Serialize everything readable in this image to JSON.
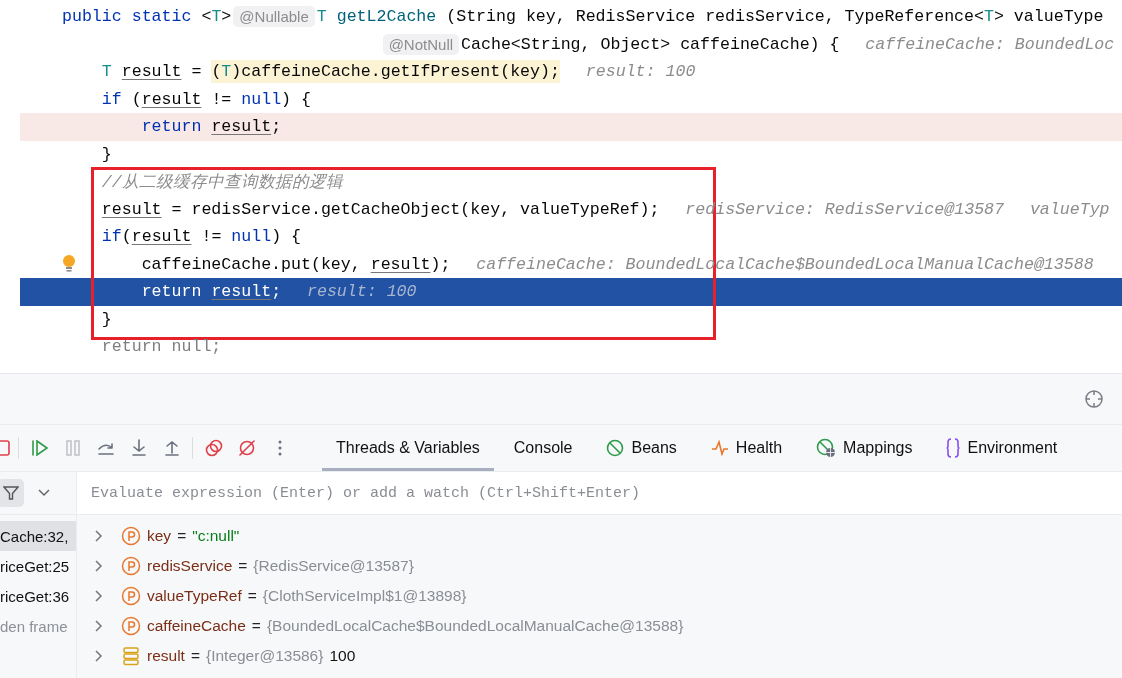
{
  "editor": {
    "lines": [
      {
        "kind": "code",
        "tinted": false,
        "execution_point": false,
        "bulb": false,
        "segments": [
          {
            "kind": "code",
            "tokens": [
              {
                "kind": "keyword",
                "text": "public static "
              },
              {
                "kind": "plain",
                "text": "<"
              },
              {
                "kind": "type",
                "text": "T"
              },
              {
                "kind": "plain",
                "text": ">"
              }
            ]
          },
          {
            "kind": "annotation",
            "text": "@Nullable"
          },
          {
            "kind": "code",
            "tokens": [
              {
                "kind": "type",
                "text": "T"
              },
              {
                "kind": "method",
                "text": " getL2Cache"
              },
              {
                "kind": "plain",
                "text": " (String key, RedisService redisService, TypeReference<"
              },
              {
                "kind": "type",
                "text": "T"
              },
              {
                "kind": "plain",
                "text": "> valueType"
              }
            ]
          }
        ],
        "children": [
          {
            "kind": "continuation",
            "tinted": false,
            "execution_point": false,
            "bulb": false,
            "segments": [
              {
                "kind": "annotation",
                "text": "@NotNull"
              },
              {
                "kind": "code",
                "tokens": [
                  {
                    "kind": "plain",
                    "text": "Cache<String, Object> caffeineCache) {"
                  }
                ]
              },
              {
                "kind": "hint",
                "text": "caffeineCache: BoundedLoc"
              }
            ]
          },
          {
            "kind": "code",
            "tinted": false,
            "execution_point": false,
            "bulb": false,
            "segments": [
              {
                "kind": "code",
                "tokens": [
                  {
                    "kind": "type",
                    "text": "T "
                  },
                  {
                    "kind": "var",
                    "text": "result"
                  },
                  {
                    "kind": "plain",
                    "text": " = "
                  },
                  {
                    "kind": "shade",
                    "tokens": [
                      {
                        "kind": "plain",
                        "text": "("
                      },
                      {
                        "kind": "type",
                        "text": "T"
                      },
                      {
                        "kind": "plain",
                        "text": ")caffeineCache.getIfPresent(key);"
                      }
                    ]
                  }
                ]
              },
              {
                "kind": "hint",
                "text": "result: 100"
              }
            ]
          },
          {
            "kind": "code",
            "tinted": false,
            "execution_point": false,
            "bulb": false,
            "segments": [
              {
                "kind": "code",
                "tokens": [
                  {
                    "kind": "keyword",
                    "text": "if"
                  },
                  {
                    "kind": "plain",
                    "text": " ("
                  },
                  {
                    "kind": "var",
                    "text": "result"
                  },
                  {
                    "kind": "plain",
                    "text": " != "
                  },
                  {
                    "kind": "keyword",
                    "text": "null"
                  },
                  {
                    "kind": "plain",
                    "text": ") {"
                  }
                ]
              }
            ],
            "children": [
              {
                "kind": "code",
                "tinted": true,
                "execution_point": false,
                "bulb": false,
                "segments": [
                  {
                    "kind": "code",
                    "tokens": [
                      {
                        "kind": "keyword",
                        "text": "return "
                      },
                      {
                        "kind": "var",
                        "text": "result"
                      },
                      {
                        "kind": "plain",
                        "text": ";"
                      }
                    ]
                  }
                ]
              }
            ]
          },
          {
            "kind": "code",
            "tinted": false,
            "execution_point": false,
            "bulb": false,
            "segments": [
              {
                "kind": "code",
                "tokens": [
                  {
                    "kind": "plain",
                    "text": "}"
                  }
                ]
              }
            ]
          },
          {
            "kind": "code",
            "tinted": false,
            "execution_point": false,
            "bulb": false,
            "segments": [
              {
                "kind": "code",
                "tokens": [
                  {
                    "kind": "comment",
                    "text": "//从二级缓存中查询数据的逻辑"
                  }
                ]
              }
            ]
          },
          {
            "kind": "code",
            "tinted": false,
            "execution_point": false,
            "bulb": false,
            "segments": [
              {
                "kind": "code",
                "tokens": [
                  {
                    "kind": "var",
                    "text": "result"
                  },
                  {
                    "kind": "plain",
                    "text": " = redisService.getCacheObject(key, valueTypeRef);"
                  }
                ]
              },
              {
                "kind": "hint",
                "text": "redisService: RedisService@13587"
              },
              {
                "kind": "hint",
                "text": "valueTyp"
              }
            ]
          },
          {
            "kind": "code",
            "tinted": false,
            "execution_point": false,
            "bulb": false,
            "segments": [
              {
                "kind": "code",
                "tokens": [
                  {
                    "kind": "keyword",
                    "text": "if"
                  },
                  {
                    "kind": "plain",
                    "text": "("
                  },
                  {
                    "kind": "var",
                    "text": "result"
                  },
                  {
                    "kind": "plain",
                    "text": " != "
                  },
                  {
                    "kind": "keyword",
                    "text": "null"
                  },
                  {
                    "kind": "plain",
                    "text": ") {"
                  }
                ]
              }
            ],
            "children": [
              {
                "kind": "code",
                "tinted": false,
                "execution_point": false,
                "bulb": true,
                "segments": [
                  {
                    "kind": "code",
                    "tokens": [
                      {
                        "kind": "plain",
                        "text": "caffeineCache.put(key, "
                      },
                      {
                        "kind": "var",
                        "text": "result"
                      },
                      {
                        "kind": "plain",
                        "text": ");"
                      }
                    ]
                  },
                  {
                    "kind": "hint",
                    "text": "caffeineCache: BoundedLocalCache$BoundedLocalManualCache@13588"
                  }
                ]
              },
              {
                "kind": "code",
                "tinted": false,
                "execution_point": true,
                "bulb": false,
                "segments": [
                  {
                    "kind": "code",
                    "tokens": [
                      {
                        "kind": "keyword",
                        "text": "return "
                      },
                      {
                        "kind": "var",
                        "text": "result"
                      },
                      {
                        "kind": "plain",
                        "text": ";"
                      }
                    ]
                  },
                  {
                    "kind": "hint",
                    "text": "result: 100"
                  }
                ]
              }
            ]
          },
          {
            "kind": "code",
            "tinted": false,
            "execution_point": false,
            "bulb": false,
            "segments": [
              {
                "kind": "code",
                "tokens": [
                  {
                    "kind": "plain",
                    "text": "}"
                  }
                ]
              }
            ]
          },
          {
            "kind": "code",
            "tinted": false,
            "execution_point": false,
            "bulb": false,
            "segments": [
              {
                "kind": "code",
                "tokens": [
                  {
                    "kind": "dim",
                    "text": "return null;"
                  }
                ]
              }
            ]
          }
        ]
      }
    ]
  },
  "debugger": {
    "toolbar": [
      {
        "disabled": false
      },
      {
        "disabled": false
      },
      {
        "disabled": true
      },
      {
        "disabled": false
      },
      {
        "disabled": false
      },
      {
        "disabled": false
      },
      {
        "disabled": false
      },
      {
        "disabled": false
      },
      {
        "disabled": false
      }
    ],
    "tabs": [
      {
        "label": "Threads & Variables",
        "selected": true
      },
      {
        "label": "Console",
        "selected": false
      },
      {
        "label": "Beans",
        "selected": false
      },
      {
        "label": "Health",
        "selected": false
      },
      {
        "label": "Mappings",
        "selected": false
      },
      {
        "label": "Environment",
        "selected": false
      }
    ],
    "evaluate": {
      "placeholder": "Evaluate expression (Enter) or add a watch (Ctrl+Shift+Enter)"
    },
    "frames": [
      {
        "kind": "frame",
        "text": "Cache:32,",
        "selected": true
      },
      {
        "kind": "frame",
        "text": "riceGet:25",
        "selected": false
      },
      {
        "kind": "frame",
        "text": "riceGet:36",
        "selected": false
      },
      {
        "kind": "hidden",
        "text": "den frame",
        "selected": false
      }
    ],
    "variables": [
      {
        "kind": "param",
        "name": "key",
        "separator": "=",
        "is_string": true,
        "value": "\"c:null\"",
        "expanded": false
      },
      {
        "kind": "param",
        "name": "redisService",
        "separator": "=",
        "is_string": false,
        "value": "{RedisService@13587}",
        "expanded": false
      },
      {
        "kind": "param",
        "name": "valueTypeRef",
        "separator": "=",
        "is_string": false,
        "value": "{ClothServiceImpl$1@13898}",
        "expanded": false
      },
      {
        "kind": "param",
        "name": "caffeineCache",
        "separator": "=",
        "is_string": false,
        "value": "{BoundedLocalCache$BoundedLocalManualCache@13588}",
        "expanded": false
      },
      {
        "kind": "local",
        "name": "result",
        "separator": "=",
        "is_string": false,
        "value": "{Integer@13586}",
        "display": "100",
        "expanded": false
      }
    ]
  }
}
